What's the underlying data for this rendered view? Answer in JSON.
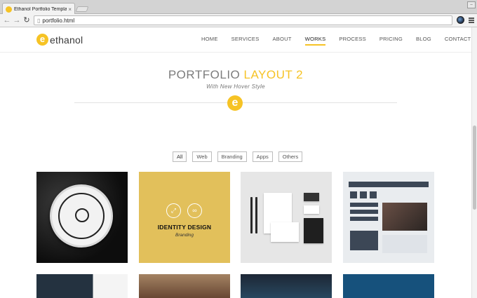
{
  "browser": {
    "tab_title": "Ethanol Portfolio Template",
    "tab_close": "×",
    "url": "portfolio.html"
  },
  "icons": {
    "favicon": "ethanol-logo-icon",
    "back": "back-arrow-icon",
    "forward": "forward-arrow-icon",
    "reload": "reload-icon",
    "page": "page-icon",
    "extension": "globe-extension-icon",
    "menu": "hamburger-menu-icon",
    "badge": "ethanol-badge-icon",
    "zoom": "magnify-icon",
    "link": "link-icon"
  },
  "site": {
    "logo_mark": "e",
    "logo_text": "ethanol",
    "nav": [
      {
        "label": "HOME"
      },
      {
        "label": "SERVICES"
      },
      {
        "label": "ABOUT"
      },
      {
        "label": "WORKS",
        "active": true
      },
      {
        "label": "PROCESS"
      },
      {
        "label": "PRICING"
      },
      {
        "label": "BLOG"
      },
      {
        "label": "CONTACT"
      }
    ]
  },
  "section": {
    "title_main": "PORTFOLIO",
    "title_accent": "LAYOUT 2",
    "subtitle": "With New Hover Style",
    "badge_mark": "e"
  },
  "filters": [
    {
      "label": "All",
      "active": true
    },
    {
      "label": "Web"
    },
    {
      "label": "Branding"
    },
    {
      "label": "Apps"
    },
    {
      "label": "Others"
    }
  ],
  "portfolio": {
    "hover_item": {
      "title": "IDENTITY DESIGN",
      "category": "Branding"
    }
  },
  "colors": {
    "accent": "#f6c325",
    "hover_bg": "#d7b558",
    "text": "#555555",
    "chrome": "#d3d3d3"
  }
}
